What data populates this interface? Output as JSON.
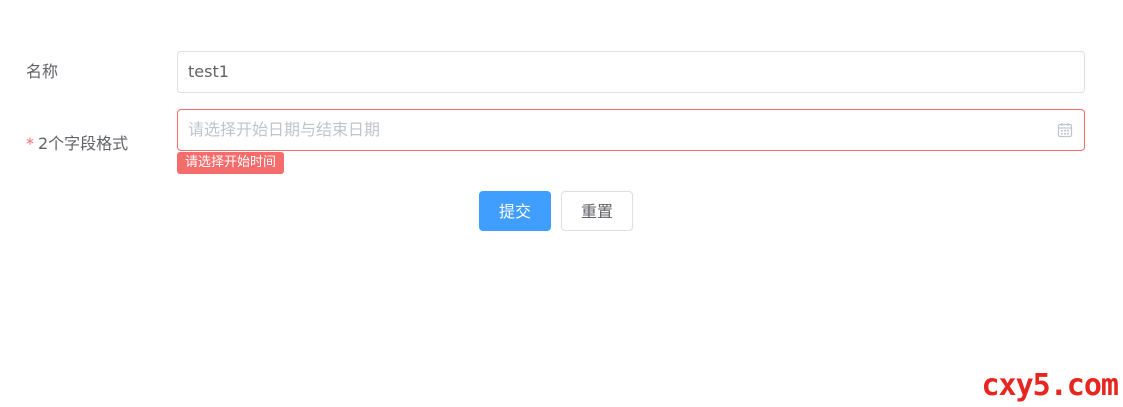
{
  "form": {
    "name_row": {
      "label": "名称",
      "value": "test1"
    },
    "range_row": {
      "required_mark": "*",
      "label": "2个字段格式",
      "placeholder": "请选择开始日期与结束日期",
      "icon": "calendar-icon",
      "error_message": "请选择开始时间"
    },
    "buttons": {
      "submit_label": "提交",
      "reset_label": "重置"
    }
  },
  "watermark": {
    "text": "cxy5.com"
  },
  "colors": {
    "primary": "#409eff",
    "error": "#f56c6c",
    "text": "#606266",
    "placeholder": "#c0c4cc",
    "border": "#dcdfe6",
    "watermark": "#e6261f"
  }
}
